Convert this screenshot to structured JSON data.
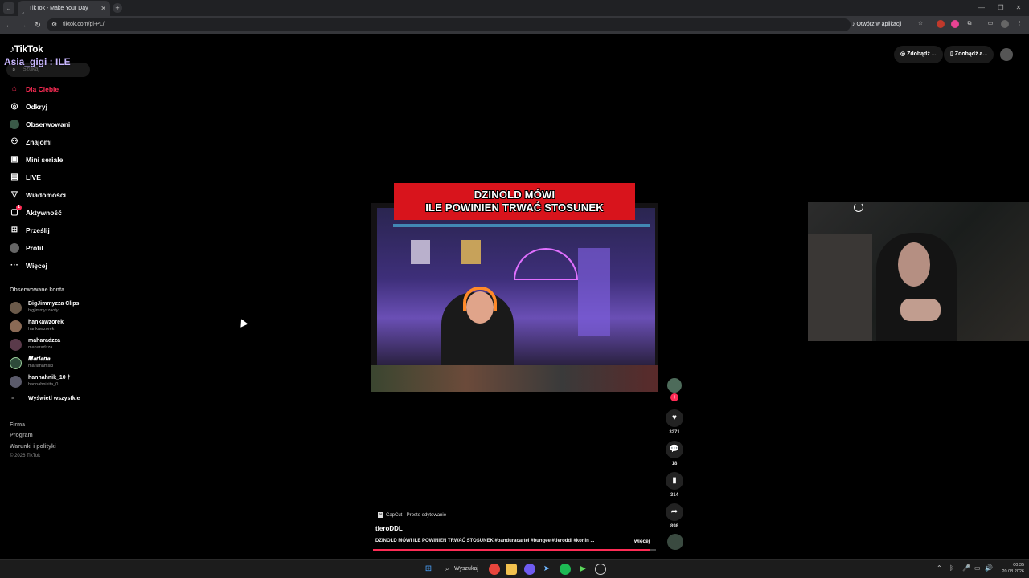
{
  "browser": {
    "tab_title": "TikTok - Make Your Day",
    "url": "tiktok.com/pl-PL/",
    "open_in_app": "Otwórz w aplikacji"
  },
  "overlay": {
    "stream_text": "Asia_gigi : ILE"
  },
  "sidebar": {
    "logo": "TikTok",
    "search_placeholder": "Szukaj",
    "nav": [
      {
        "label": "Dla Ciebie",
        "icon": "home-icon"
      },
      {
        "label": "Odkryj",
        "icon": "compass-icon"
      },
      {
        "label": "Obserwowani",
        "icon": "following-icon"
      },
      {
        "label": "Znajomi",
        "icon": "friends-icon"
      },
      {
        "label": "Mini seriale",
        "icon": "series-icon"
      },
      {
        "label": "LIVE",
        "icon": "live-icon"
      },
      {
        "label": "Wiadomości",
        "icon": "messages-icon"
      },
      {
        "label": "Aktywność",
        "icon": "activity-icon",
        "badge": "1"
      },
      {
        "label": "Prześlij",
        "icon": "upload-icon"
      },
      {
        "label": "Profil",
        "icon": "profile-icon"
      },
      {
        "label": "Więcej",
        "icon": "more-icon"
      }
    ],
    "followed_title": "Obserwowane konta",
    "accounts": [
      {
        "name": "BigJimmyzza Clips",
        "handle": "bigjimmyzzaoty"
      },
      {
        "name": "hankawzorek",
        "handle": "hankawzorek"
      },
      {
        "name": "maharadzza",
        "handle": "maharadzza"
      },
      {
        "name": "𝑴𝒂𝒓𝒊𝒂𝒏𝒂",
        "handle": "marianamski"
      },
      {
        "name": "hannahnik_10 †",
        "handle": "hannahnikita_0"
      }
    ],
    "show_all": "Wyświetl wszystkie",
    "footer": [
      "Firma",
      "Program",
      "Warunki i polityki"
    ],
    "copyright": "© 2026 TikTok"
  },
  "header_buttons": {
    "btn1": "Zdobądź ...",
    "btn2": "Zdobądź a..."
  },
  "video": {
    "caption_line1": "DZINOLD MÓWI",
    "caption_line2": "ILE POWINIEN TRWAĆ STOSUNEK",
    "capcut": "CapCut · Proste edytowanie",
    "username": "tieroDDL",
    "description": "DZINOLD MÓWI ILE POWINIEN TRWAĆ STOSUNEK #banduracartel #bungee #tieroddl #konin ...",
    "more": "więcej",
    "progress": 0.98
  },
  "actions": {
    "likes": "3271",
    "comments": "18",
    "saves": "314",
    "shares": "898"
  },
  "taskbar": {
    "search": "Wyszukaj",
    "time": "00:35",
    "date": "20.08.2026"
  }
}
